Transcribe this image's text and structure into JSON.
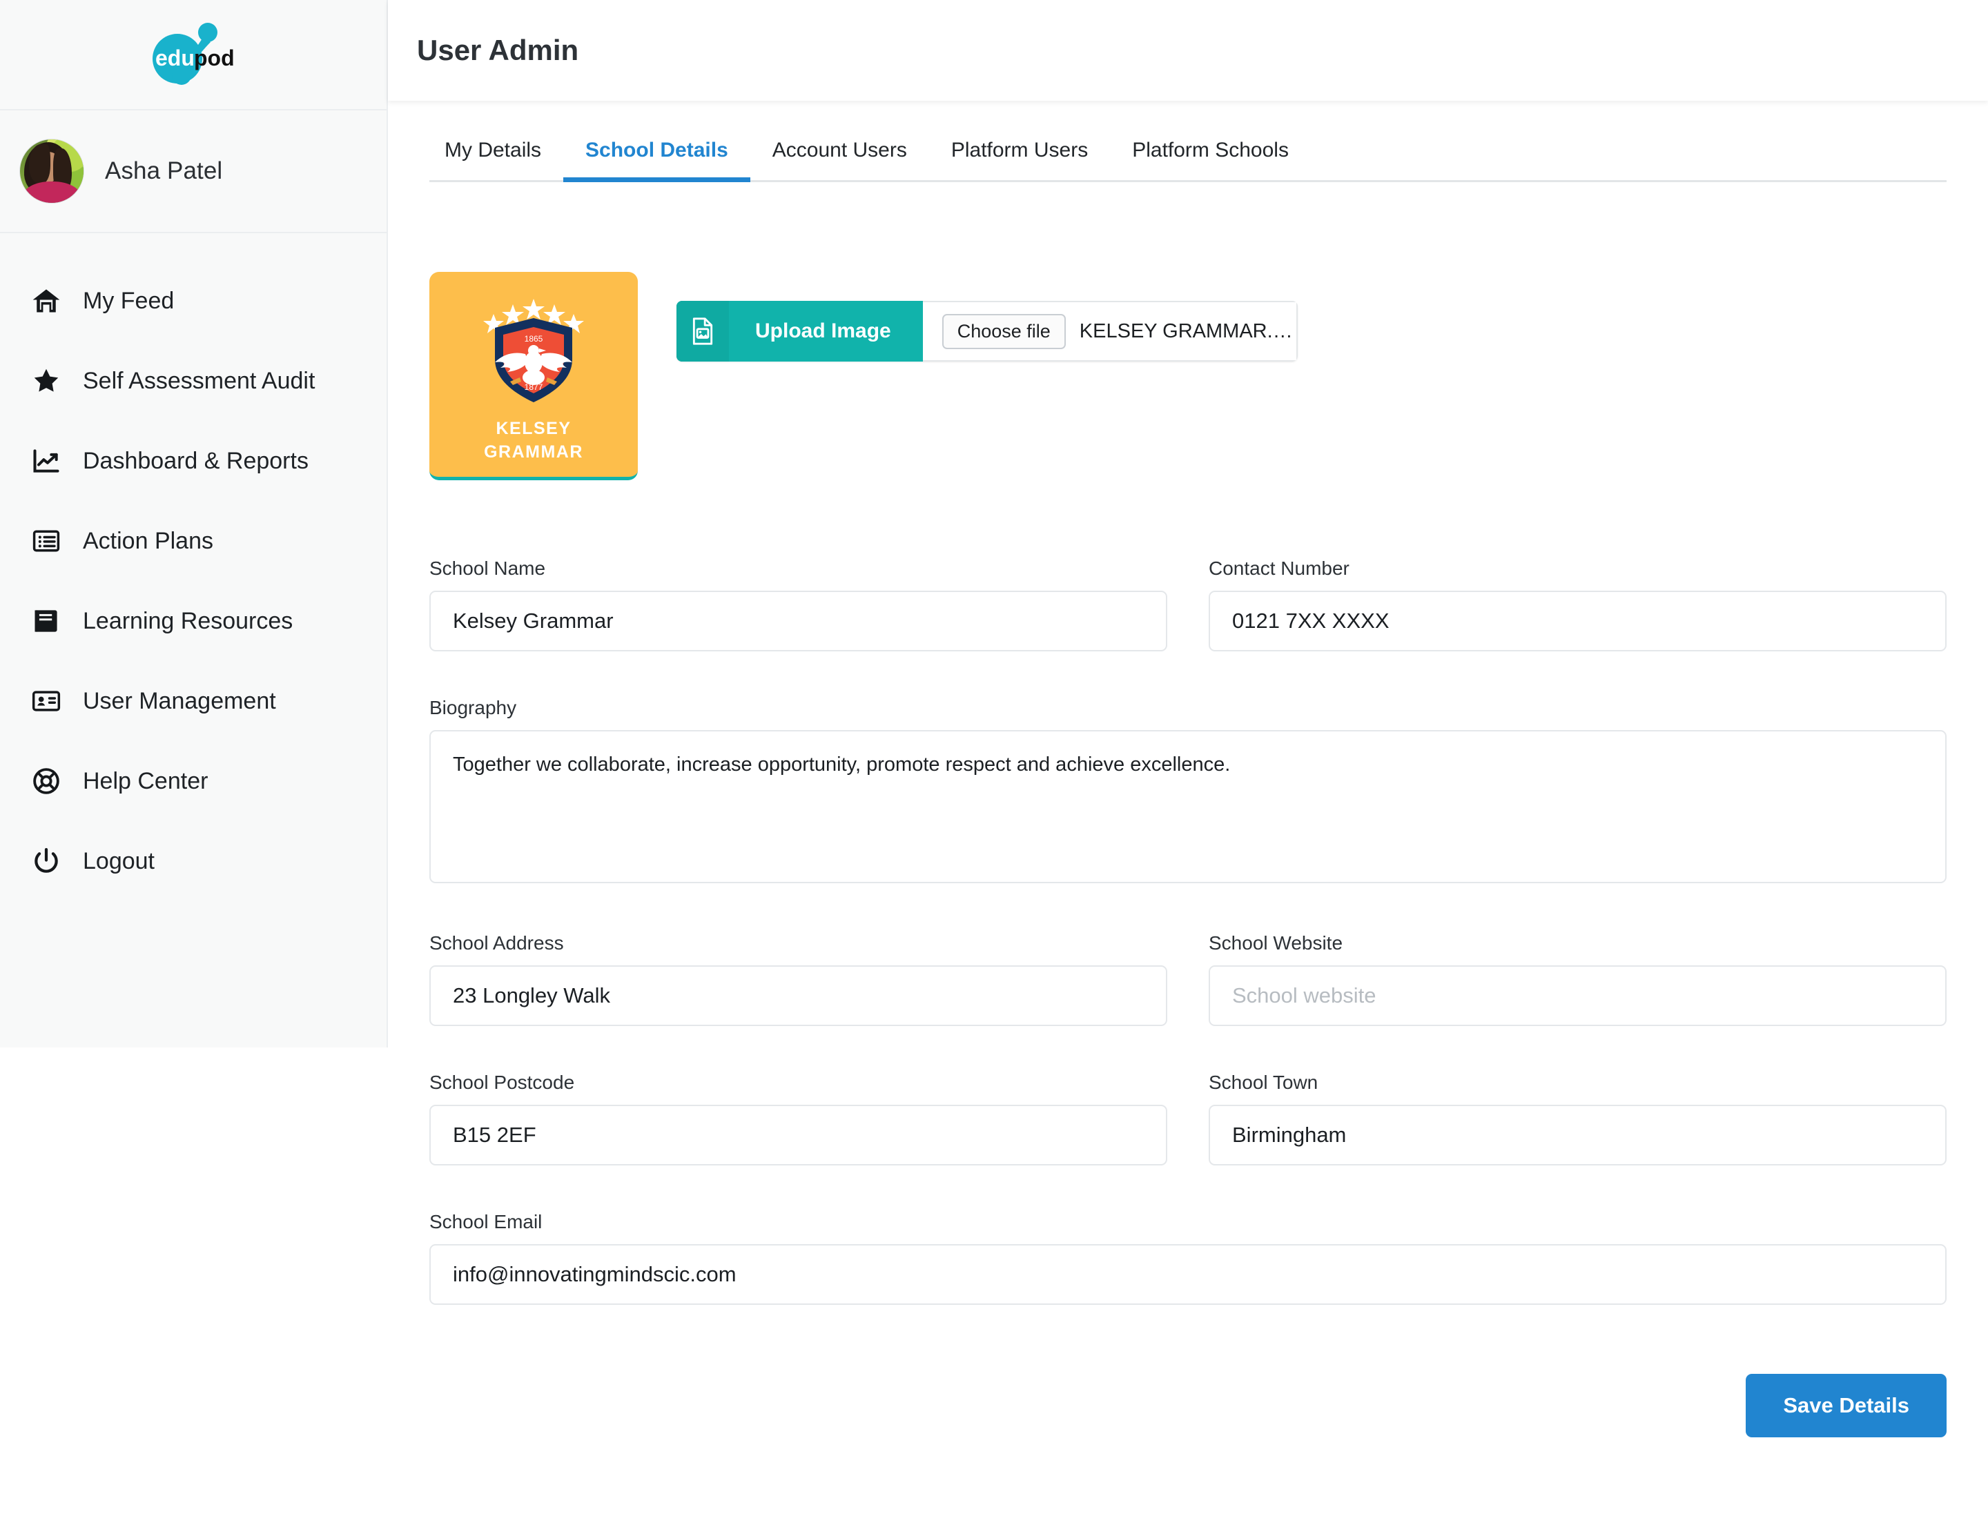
{
  "brand": {
    "logo_text_edu": "edu",
    "logo_text_pod": "pod",
    "logo_color": "#19B2CC"
  },
  "sidebar": {
    "user": {
      "name": "Asha Patel",
      "avatar_alt": "Asha Patel profile photo"
    },
    "items": [
      {
        "label": "My Feed",
        "icon": "home-icon"
      },
      {
        "label": "Self Assessment Audit",
        "icon": "star-icon"
      },
      {
        "label": "Dashboard & Reports",
        "icon": "chart-line-icon"
      },
      {
        "label": "Action Plans",
        "icon": "list-icon"
      },
      {
        "label": "Learning Resources",
        "icon": "book-icon"
      },
      {
        "label": "User Management",
        "icon": "id-card-icon"
      },
      {
        "label": "Help Center",
        "icon": "lifebuoy-icon"
      },
      {
        "label": "Logout",
        "icon": "power-icon"
      }
    ]
  },
  "header": {
    "title": "User Admin"
  },
  "tabs": {
    "items": [
      {
        "label": "My Details",
        "active": false
      },
      {
        "label": "School Details",
        "active": true
      },
      {
        "label": "Account Users",
        "active": false
      },
      {
        "label": "Platform Users",
        "active": false
      },
      {
        "label": "Platform Schools",
        "active": false
      }
    ],
    "active_color": "#2185D0"
  },
  "crest": {
    "name_line1": "KELSEY",
    "name_line2": "GRAMMAR",
    "year_top": "1865",
    "year_bottom": "1877",
    "card_color": "#FDBE4B",
    "shield_border_color": "#12305E",
    "shield_fill_color": "#EE4E36",
    "accent_underline_color": "#12B2AB",
    "star_count": 5
  },
  "upload": {
    "button_label": "Upload Image",
    "button_color": "#11B3AB",
    "icon": "file-image-icon",
    "choose_file_label": "Choose file",
    "file_name": "KELSEY GRAMMAR.png"
  },
  "form": {
    "school_name": {
      "label": "School Name",
      "value": "Kelsey Grammar",
      "placeholder": "School name"
    },
    "contact_number": {
      "label": "Contact Number",
      "value": "0121 7XX XXXX",
      "placeholder": "Contact number"
    },
    "biography": {
      "label": "Biography",
      "value": "Together we collaborate, increase opportunity, promote respect and achieve excellence.",
      "placeholder": "Biography"
    },
    "school_address": {
      "label": "School Address",
      "value": "23 Longley Walk",
      "placeholder": "School address"
    },
    "school_website": {
      "label": "School Website",
      "value": "",
      "placeholder": "School website"
    },
    "school_postcode": {
      "label": "School Postcode",
      "value": "B15 2EF",
      "placeholder": "School postcode"
    },
    "school_town": {
      "label": "School Town",
      "value": "Birmingham",
      "placeholder": "School town"
    },
    "school_email": {
      "label": "School Email",
      "value": "info@innovatingmindscic.com",
      "placeholder": "School email"
    }
  },
  "actions": {
    "save_label": "Save Details",
    "save_color": "#2185D0"
  }
}
